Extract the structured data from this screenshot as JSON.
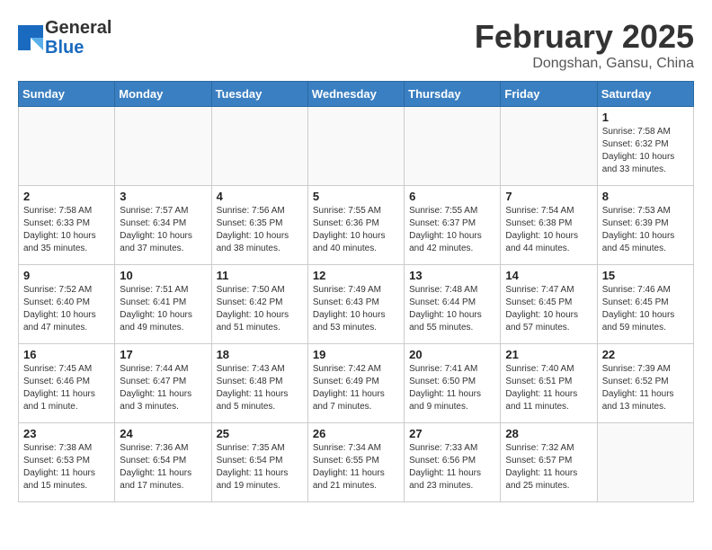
{
  "header": {
    "logo_general": "General",
    "logo_blue": "Blue",
    "month_title": "February 2025",
    "location": "Dongshan, Gansu, China"
  },
  "weekdays": [
    "Sunday",
    "Monday",
    "Tuesday",
    "Wednesday",
    "Thursday",
    "Friday",
    "Saturday"
  ],
  "weeks": [
    [
      {
        "day": "",
        "empty": true
      },
      {
        "day": "",
        "empty": true
      },
      {
        "day": "",
        "empty": true
      },
      {
        "day": "",
        "empty": true
      },
      {
        "day": "",
        "empty": true
      },
      {
        "day": "",
        "empty": true
      },
      {
        "day": "1",
        "sunrise": "7:58 AM",
        "sunset": "6:32 PM",
        "daylight": "10 hours and 33 minutes."
      }
    ],
    [
      {
        "day": "2",
        "sunrise": "7:58 AM",
        "sunset": "6:33 PM",
        "daylight": "10 hours and 35 minutes."
      },
      {
        "day": "3",
        "sunrise": "7:57 AM",
        "sunset": "6:34 PM",
        "daylight": "10 hours and 37 minutes."
      },
      {
        "day": "4",
        "sunrise": "7:56 AM",
        "sunset": "6:35 PM",
        "daylight": "10 hours and 38 minutes."
      },
      {
        "day": "5",
        "sunrise": "7:55 AM",
        "sunset": "6:36 PM",
        "daylight": "10 hours and 40 minutes."
      },
      {
        "day": "6",
        "sunrise": "7:55 AM",
        "sunset": "6:37 PM",
        "daylight": "10 hours and 42 minutes."
      },
      {
        "day": "7",
        "sunrise": "7:54 AM",
        "sunset": "6:38 PM",
        "daylight": "10 hours and 44 minutes."
      },
      {
        "day": "8",
        "sunrise": "7:53 AM",
        "sunset": "6:39 PM",
        "daylight": "10 hours and 45 minutes."
      }
    ],
    [
      {
        "day": "9",
        "sunrise": "7:52 AM",
        "sunset": "6:40 PM",
        "daylight": "10 hours and 47 minutes."
      },
      {
        "day": "10",
        "sunrise": "7:51 AM",
        "sunset": "6:41 PM",
        "daylight": "10 hours and 49 minutes."
      },
      {
        "day": "11",
        "sunrise": "7:50 AM",
        "sunset": "6:42 PM",
        "daylight": "10 hours and 51 minutes."
      },
      {
        "day": "12",
        "sunrise": "7:49 AM",
        "sunset": "6:43 PM",
        "daylight": "10 hours and 53 minutes."
      },
      {
        "day": "13",
        "sunrise": "7:48 AM",
        "sunset": "6:44 PM",
        "daylight": "10 hours and 55 minutes."
      },
      {
        "day": "14",
        "sunrise": "7:47 AM",
        "sunset": "6:45 PM",
        "daylight": "10 hours and 57 minutes."
      },
      {
        "day": "15",
        "sunrise": "7:46 AM",
        "sunset": "6:45 PM",
        "daylight": "10 hours and 59 minutes."
      }
    ],
    [
      {
        "day": "16",
        "sunrise": "7:45 AM",
        "sunset": "6:46 PM",
        "daylight": "11 hours and 1 minute."
      },
      {
        "day": "17",
        "sunrise": "7:44 AM",
        "sunset": "6:47 PM",
        "daylight": "11 hours and 3 minutes."
      },
      {
        "day": "18",
        "sunrise": "7:43 AM",
        "sunset": "6:48 PM",
        "daylight": "11 hours and 5 minutes."
      },
      {
        "day": "19",
        "sunrise": "7:42 AM",
        "sunset": "6:49 PM",
        "daylight": "11 hours and 7 minutes."
      },
      {
        "day": "20",
        "sunrise": "7:41 AM",
        "sunset": "6:50 PM",
        "daylight": "11 hours and 9 minutes."
      },
      {
        "day": "21",
        "sunrise": "7:40 AM",
        "sunset": "6:51 PM",
        "daylight": "11 hours and 11 minutes."
      },
      {
        "day": "22",
        "sunrise": "7:39 AM",
        "sunset": "6:52 PM",
        "daylight": "11 hours and 13 minutes."
      }
    ],
    [
      {
        "day": "23",
        "sunrise": "7:38 AM",
        "sunset": "6:53 PM",
        "daylight": "11 hours and 15 minutes."
      },
      {
        "day": "24",
        "sunrise": "7:36 AM",
        "sunset": "6:54 PM",
        "daylight": "11 hours and 17 minutes."
      },
      {
        "day": "25",
        "sunrise": "7:35 AM",
        "sunset": "6:54 PM",
        "daylight": "11 hours and 19 minutes."
      },
      {
        "day": "26",
        "sunrise": "7:34 AM",
        "sunset": "6:55 PM",
        "daylight": "11 hours and 21 minutes."
      },
      {
        "day": "27",
        "sunrise": "7:33 AM",
        "sunset": "6:56 PM",
        "daylight": "11 hours and 23 minutes."
      },
      {
        "day": "28",
        "sunrise": "7:32 AM",
        "sunset": "6:57 PM",
        "daylight": "11 hours and 25 minutes."
      },
      {
        "day": "",
        "empty": true
      }
    ]
  ]
}
